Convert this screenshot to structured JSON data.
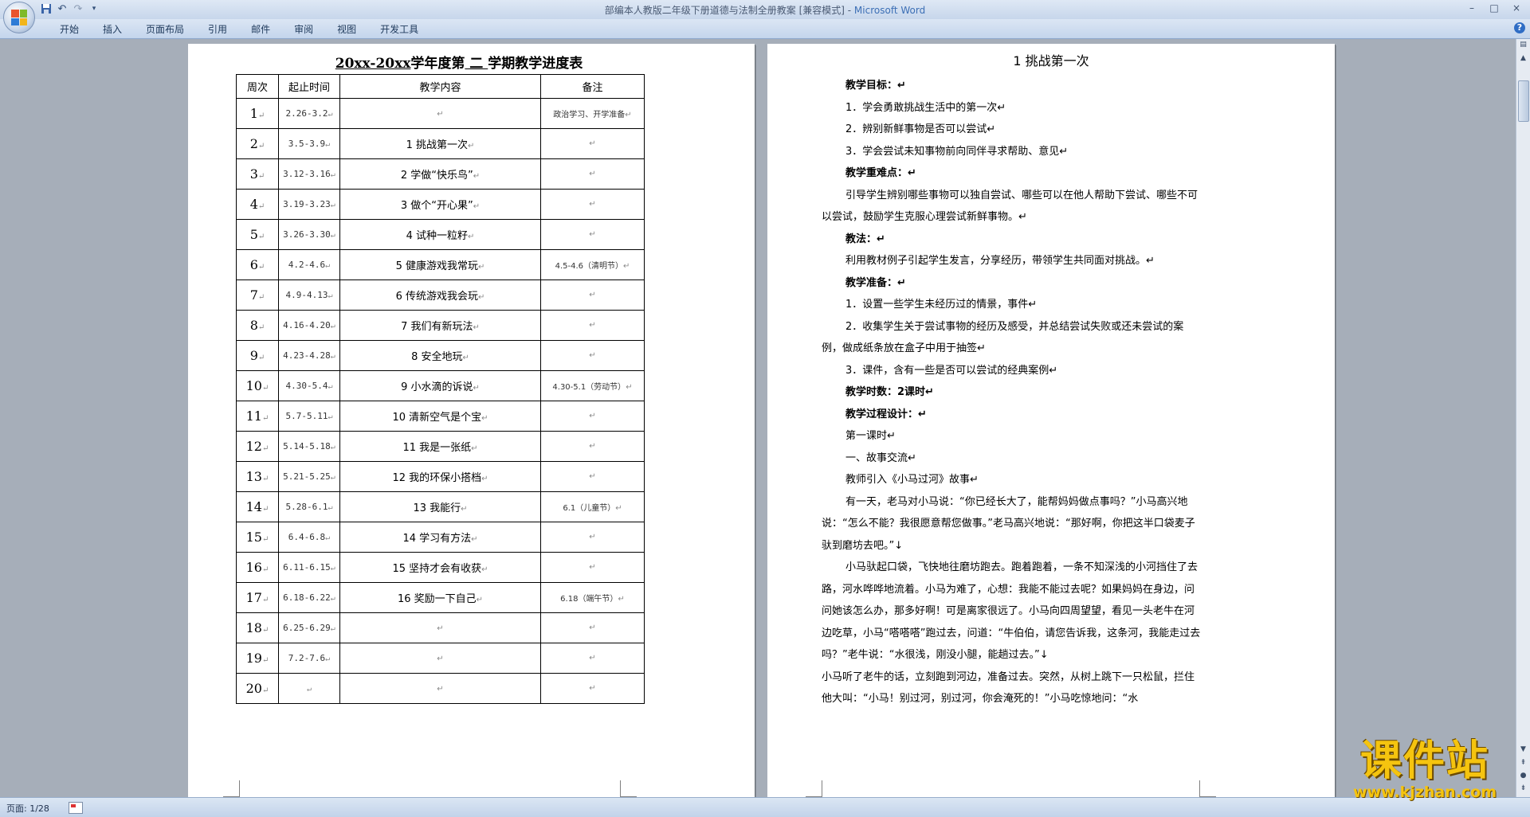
{
  "window": {
    "title_doc": "部编本人教版二年级下册道德与法制全册教案 [兼容模式] - ",
    "title_app": "Microsoft Word",
    "controls": [
      "–",
      "□",
      "×"
    ]
  },
  "qat": {
    "save_icon": "save-icon",
    "undo_icon": "undo-icon",
    "redo_icon": "redo-icon",
    "customize_icon": "customize-icon"
  },
  "ribbon": {
    "tabs": [
      "开始",
      "插入",
      "页面布局",
      "引用",
      "邮件",
      "审阅",
      "视图",
      "开发工具"
    ]
  },
  "left_page": {
    "title_year": "20xx-20xx",
    "title_mid": "学年度第",
    "title_term": " 二 ",
    "title_end": "学期教学进度表",
    "columns": [
      "周次",
      "起止时间",
      "教学内容",
      "备注"
    ],
    "rows": [
      {
        "week": "1",
        "date": "2.26-3.2",
        "content": "",
        "note": "政治学习、开学准备"
      },
      {
        "week": "2",
        "date": "3.5-3.9",
        "content": "1 挑战第一次",
        "note": ""
      },
      {
        "week": "3",
        "date": "3.12-3.16",
        "content": "2 学做“快乐鸟”",
        "note": ""
      },
      {
        "week": "4",
        "date": "3.19-3.23",
        "content": "3 做个“开心果”",
        "note": ""
      },
      {
        "week": "5",
        "date": "3.26-3.30",
        "content": "4 试种一粒籽",
        "note": ""
      },
      {
        "week": "6",
        "date": "4.2-4.6",
        "content": "5 健康游戏我常玩",
        "note": "4.5-4.6（清明节）"
      },
      {
        "week": "7",
        "date": "4.9-4.13",
        "content": "6 传统游戏我会玩",
        "note": ""
      },
      {
        "week": "8",
        "date": "4.16-4.20",
        "content": "7 我们有新玩法",
        "note": ""
      },
      {
        "week": "9",
        "date": "4.23-4.28",
        "content": "8 安全地玩",
        "note": ""
      },
      {
        "week": "10",
        "date": "4.30-5.4",
        "content": "9 小水滴的诉说",
        "note": "4.30-5.1（劳动节）"
      },
      {
        "week": "11",
        "date": "5.7-5.11",
        "content": "10 清新空气是个宝",
        "note": ""
      },
      {
        "week": "12",
        "date": "5.14-5.18",
        "content": "11 我是一张纸",
        "note": ""
      },
      {
        "week": "13",
        "date": "5.21-5.25",
        "content": "12 我的环保小搭档",
        "note": ""
      },
      {
        "week": "14",
        "date": "5.28-6.1",
        "content": "13 我能行",
        "note": "6.1（儿童节）"
      },
      {
        "week": "15",
        "date": "6.4-6.8",
        "content": "14 学习有方法",
        "note": ""
      },
      {
        "week": "16",
        "date": "6.11-6.15",
        "content": "15 坚持才会有收获",
        "note": ""
      },
      {
        "week": "17",
        "date": "6.18-6.22",
        "content": "16 奖励一下自己",
        "note": "6.18（端午节）"
      },
      {
        "week": "18",
        "date": "6.25-6.29",
        "content": "",
        "note": ""
      },
      {
        "week": "19",
        "date": "7.2-7.6",
        "content": "",
        "note": ""
      },
      {
        "week": "20",
        "date": "",
        "content": "",
        "note": ""
      }
    ]
  },
  "right_page": {
    "title": "1  挑战第一次",
    "paragraphs": [
      {
        "style": "ind b",
        "text": "教学目标：↵"
      },
      {
        "style": "ind",
        "text": "1．学会勇敢挑战生活中的第一次↵"
      },
      {
        "style": "ind",
        "text": "2．辨别新鲜事物是否可以尝试↵"
      },
      {
        "style": "ind",
        "text": "3．学会尝试未知事物前向同伴寻求帮助、意见↵"
      },
      {
        "style": "ind b",
        "text": "教学重难点：↵"
      },
      {
        "style": "ind",
        "text": "引导学生辨别哪些事物可以独自尝试、哪些可以在他人帮助下尝试、哪些不可以尝试，鼓励学生克服心理尝试新鲜事物。↵"
      },
      {
        "style": "ind b",
        "text": "教法：↵"
      },
      {
        "style": "ind",
        "text": "利用教材例子引起学生发言，分享经历，带领学生共同面对挑战。↵"
      },
      {
        "style": "ind b",
        "text": "教学准备：↵"
      },
      {
        "style": "ind",
        "text": "1．设置一些学生未经历过的情景，事件↵"
      },
      {
        "style": "ind",
        "text": "2．收集学生关于尝试事物的经历及感受，并总结尝试失败或还未尝试的案例，做成纸条放在盒子中用于抽签↵"
      },
      {
        "style": "ind",
        "text": "3．课件，含有一些是否可以尝试的经典案例↵"
      },
      {
        "style": "ind b",
        "text": "教学时数：2课时↵"
      },
      {
        "style": "ind b",
        "text": "教学过程设计：↵"
      },
      {
        "style": "ind",
        "text": "第一课时↵"
      },
      {
        "style": "ind",
        "text": "一、故事交流↵"
      },
      {
        "style": "ind",
        "text": "教师引入《小马过河》故事↵"
      },
      {
        "style": "ind",
        "text": "有一天，老马对小马说：“你已经长大了，能帮妈妈做点事吗？”小马高兴地说：“怎么不能？我很愿意帮您做事。”老马高兴地说：“那好啊，你把这半口袋麦子驮到磨坊去吧。”↓"
      },
      {
        "style": "ind",
        "text": "小马驮起口袋，飞快地往磨坊跑去。跑着跑着，一条不知深浅的小河挡住了去路，河水哗哗地流着。小马为难了，心想：我能不能过去呢？如果妈妈在身边，问问她该怎么办，那多好啊！可是离家很远了。小马向四周望望，看见一头老牛在河边吃草，小马“嗒嗒嗒”跑过去，问道：“牛伯伯，请您告诉我，这条河，我能走过去吗？”老牛说：“水很浅，刚没小腿，能趟过去。”↓"
      },
      {
        "style": "",
        "text": "小马听了老牛的话，立刻跑到河边，准备过去。突然，从树上跳下一只松鼠，拦住他大叫：“小马！别过河，别过河，你会淹死的！”小马吃惊地问：“水"
      }
    ]
  },
  "status": {
    "page": "页面: 1/28",
    "icon": "spell-check-icon"
  },
  "watermark": {
    "brand": "课件站",
    "url": "www.kjzhan.com"
  },
  "colors": {
    "title_app": "#3c6fb5",
    "watermark": "#f5c40f",
    "workspace": "#a6aeb9"
  }
}
